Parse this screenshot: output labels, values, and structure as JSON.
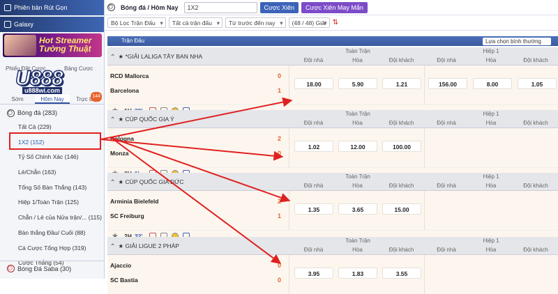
{
  "sidebar": {
    "top_links": [
      "Phiên bản Rút Gọn",
      "Galaxy"
    ],
    "banner_text": "Hot Streamer Tường Thuật",
    "tabs_top": [
      "Phiếu Đặt Cược",
      "Bảng Cược"
    ],
    "logo": "U888",
    "logo_url": "u888wi.com",
    "tabs": [
      "Sớm",
      "Hôm Nay",
      "Trực tiếp"
    ],
    "live_badge": "144",
    "sport": "Bóng đá",
    "sport_count": "(283)",
    "menu": [
      {
        "label": "Tất Cả",
        "count": "(229)"
      },
      {
        "label": "1X2",
        "count": "(152)"
      },
      {
        "label": "Tỷ Số Chính Xác",
        "count": "(146)"
      },
      {
        "label": "Lẻ/Chẵn",
        "count": "(163)"
      },
      {
        "label": "Tổng Số Bàn Thắng",
        "count": "(143)"
      },
      {
        "label": "Hiệp 1/Toàn Trận",
        "count": "(125)"
      },
      {
        "label": "Chẵn / Lẻ của Nửa trận/...",
        "count": "(115)"
      },
      {
        "label": "Bàn thắng Đầu/ Cuối",
        "count": "(88)"
      },
      {
        "label": "Cá Cược Tổng Hợp",
        "count": "(319)"
      },
      {
        "label": "Cược Thắng",
        "count": "(54)"
      }
    ],
    "sport2": "Bóng Đá Saba",
    "sport2_count": "(30)"
  },
  "topbar": {
    "title": "Bóng đá / Hôm Nay",
    "select": "1X2",
    "btn1": "Cược Xiên",
    "btn2": "Cược Xiên May Mắn"
  },
  "filters": [
    "Bộ Lọc Trận Đấu",
    "Tất cả trận đấu",
    "Từ trước đến nay",
    "(48 / 48) Giải"
  ],
  "header": {
    "label": "Trận Đấu",
    "sort": "Lựa chọn bình thường"
  },
  "groups": {
    "full": "Toàn Trận",
    "half": "Hiệp 1"
  },
  "cols": [
    "Đội nhà",
    "Hòa",
    "Đội khách"
  ],
  "leagues": [
    {
      "name": "*GIẢI LALIGA TÂY BAN NHA",
      "home": "RCD Mallorca",
      "away": "Barcelona",
      "home_score": "0",
      "away_score": "1",
      "time": "1H",
      "minute": "39'",
      "odds": [
        "18.00",
        "5.90",
        "1.21"
      ],
      "half_odds": [
        "156.00",
        "8.00",
        "1.05"
      ]
    },
    {
      "name": "CÚP QUỐC GIA Ý",
      "home": "Bologna",
      "away": "Monza",
      "home_score": "2",
      "away_score": "0",
      "time": "2H",
      "minute": "6'",
      "odds": [
        "1.02",
        "12.00",
        "100.00"
      ],
      "half_odds": []
    },
    {
      "name": "CÚP QUỐC GIA ĐỨC",
      "home": "Arminia Bielefeld",
      "away": "SC Freiburg",
      "home_score": "2",
      "away_score": "1",
      "time": "2H",
      "minute": "32'",
      "odds": [
        "1.35",
        "3.65",
        "15.00"
      ],
      "half_odds": []
    },
    {
      "name": "GIẢI LIGUE 2 PHÁP",
      "home": "Ajaccio",
      "away": "SC Bastia",
      "home_score": "0",
      "away_score": "0",
      "time": "",
      "minute": "",
      "odds": [
        "3.95",
        "1.83",
        "3.55"
      ],
      "half_odds": []
    }
  ],
  "colors": {
    "accent": "#3d63b8",
    "highlight": "#e02020",
    "score": "#e8632b"
  }
}
